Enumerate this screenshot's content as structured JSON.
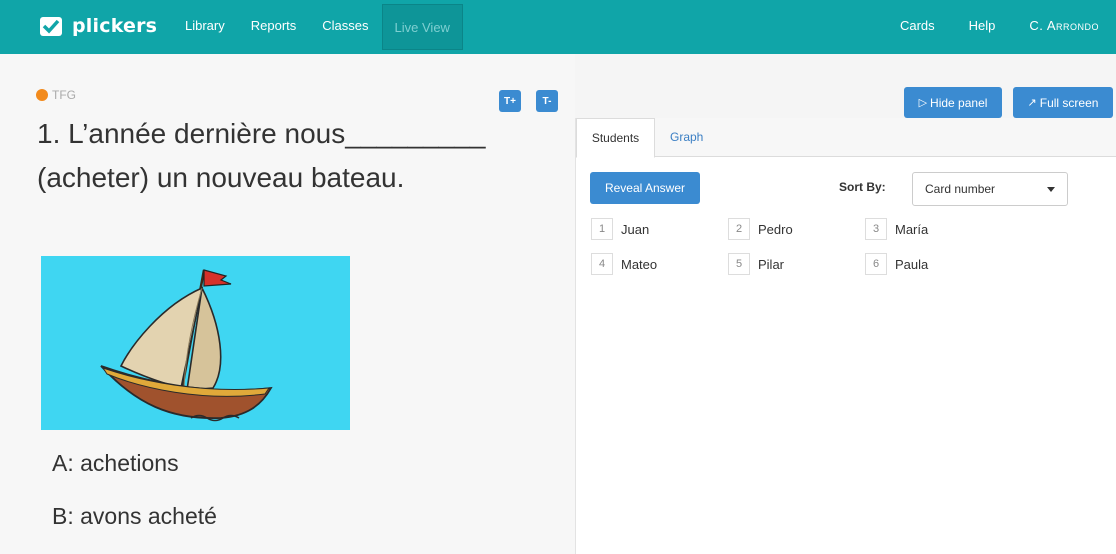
{
  "brand": {
    "name": "plickers"
  },
  "nav": {
    "left": [
      "Library",
      "Reports",
      "Classes",
      "Live View"
    ],
    "right": [
      "Cards",
      "Help",
      "C. Arrondo"
    ]
  },
  "question": {
    "set_name": "TFG",
    "text": "1. L’année dernière nous_________ (acheter) un nouveau bateau.",
    "text_size_up": "T+",
    "text_size_down": "T-",
    "choices": [
      "A: achetions",
      "B: avons acheté"
    ]
  },
  "panel": {
    "hide_label": "Hide panel",
    "fullscreen_label": "Full screen",
    "tabs": [
      "Students",
      "Graph"
    ],
    "reveal_label": "Reveal Answer",
    "sort_label": "Sort By:",
    "sort_value": "Card number",
    "students": [
      {
        "num": "1",
        "name": "Juan"
      },
      {
        "num": "2",
        "name": "Pedro"
      },
      {
        "num": "3",
        "name": "María"
      },
      {
        "num": "4",
        "name": "Mateo"
      },
      {
        "num": "5",
        "name": "Pilar"
      },
      {
        "num": "6",
        "name": "Paula"
      }
    ]
  },
  "colors": {
    "header": "#10a5a8",
    "accent": "#3b8bd1",
    "set_dot": "#f28a1c",
    "image_bg": "#3fd6f2"
  }
}
